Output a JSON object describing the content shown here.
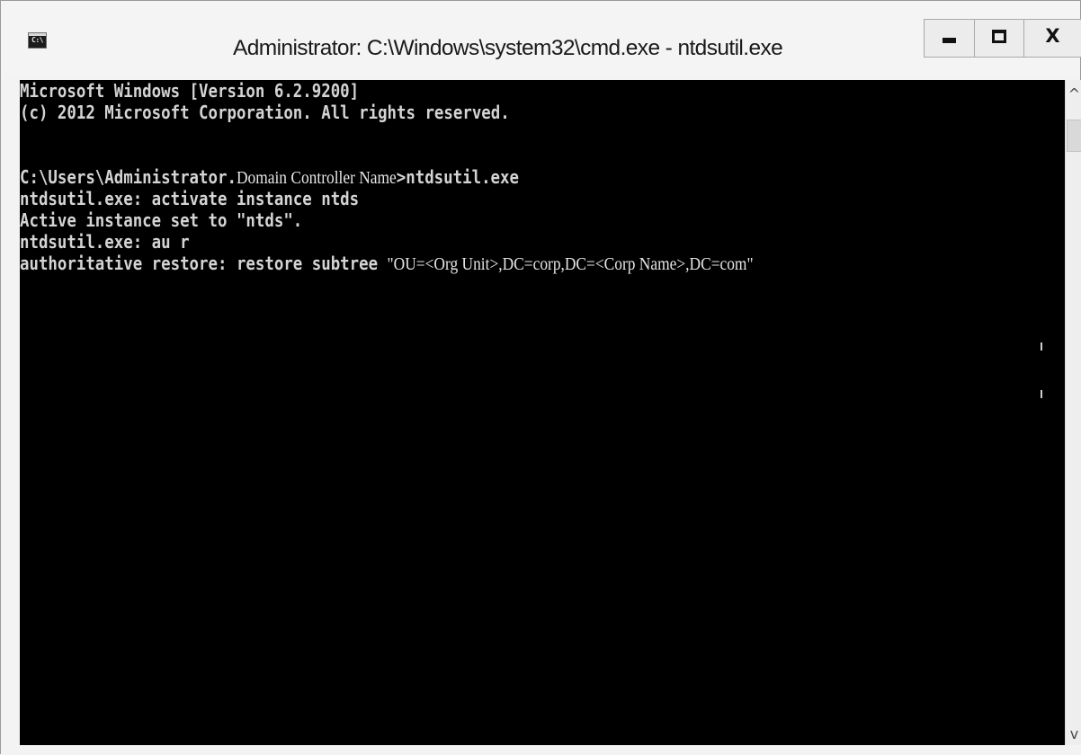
{
  "window": {
    "title": "Administrator: C:\\Windows\\system32\\cmd.exe - ntdsutil.exe",
    "icon": "cmd-icon",
    "icon_text": "C:\\",
    "controls": {
      "minimize": "minimize-icon",
      "maximize": "maximize-icon",
      "close_label": "X"
    }
  },
  "console": {
    "lines": [
      "Microsoft Windows [Version 6.2.9200]",
      "(c) 2012 Microsoft Corporation. All rights reserved.",
      "",
      "C:\\Users\\Administrator.",
      "ntdsutil.exe: activate instance ntds",
      "Active instance set to \"ntds\".",
      "ntdsutil.exe: au r",
      "authoritative restore: restore subtree "
    ],
    "prompt_domain": "Domain Controller Name",
    "prompt_suffix": ">ntdsutil.exe",
    "subtree_dn": "\"OU=<Org Unit>,DC=corp,DC=<Corp Name>,DC=com\""
  },
  "scrollbar": {
    "up_icon": "chevron-up-icon",
    "down_icon": "chevron-down-icon"
  },
  "colors": {
    "console_bg": "#000000",
    "console_text": "#d4d4d4",
    "titlebar_bg": "#f4f4f4"
  }
}
